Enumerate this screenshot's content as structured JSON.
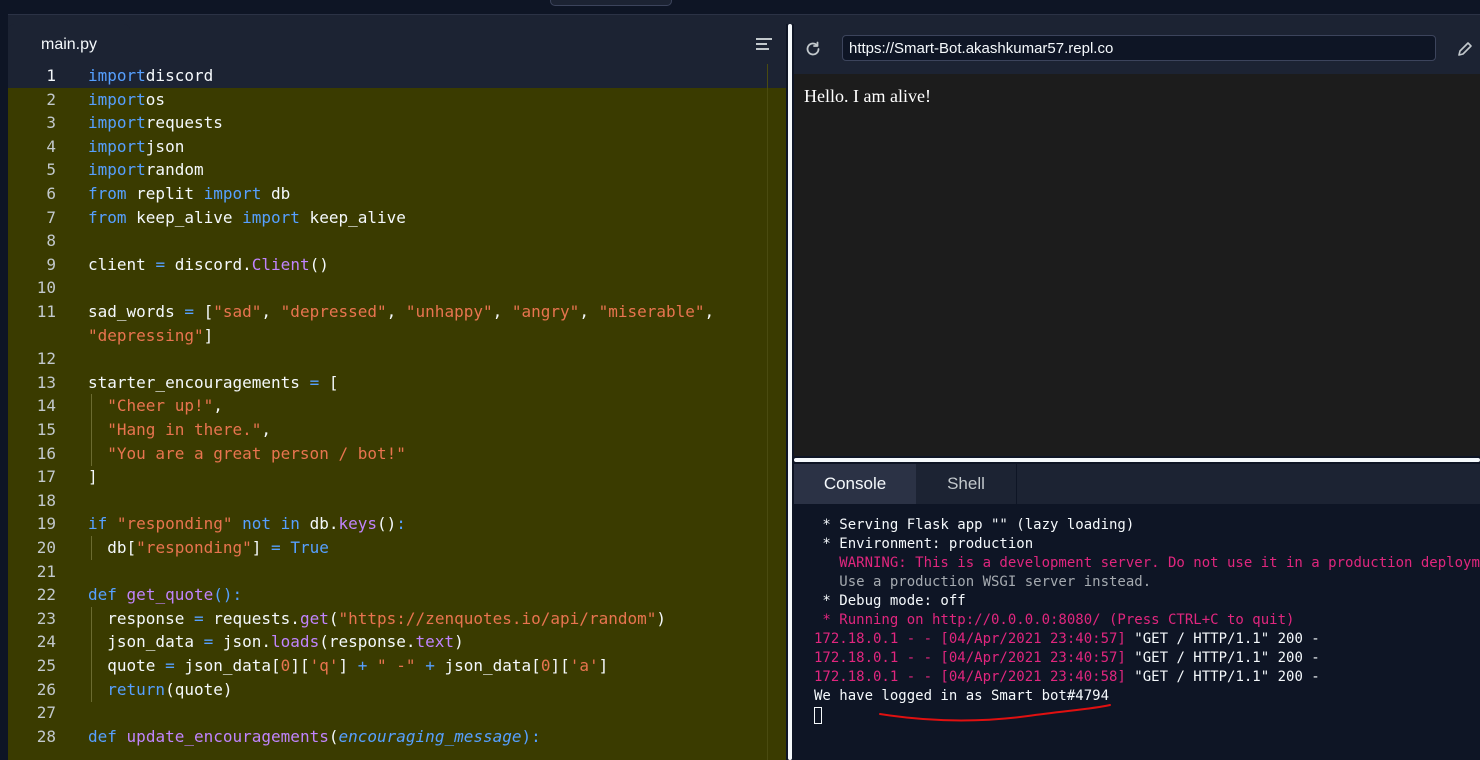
{
  "editor": {
    "file_tab": "main.py",
    "lines": [
      {
        "n": "1",
        "t": [
          [
            "kw",
            "import"
          ],
          [
            "",
            "discord"
          ]
        ]
      },
      {
        "n": "2",
        "t": [
          [
            "kw",
            "import"
          ],
          [
            "",
            "os"
          ]
        ]
      },
      {
        "n": "3",
        "t": [
          [
            "kw",
            "import"
          ],
          [
            "",
            "requests"
          ]
        ]
      },
      {
        "n": "4",
        "t": [
          [
            "kw",
            "import"
          ],
          [
            "",
            "json"
          ]
        ]
      },
      {
        "n": "5",
        "t": [
          [
            "kw",
            "import"
          ],
          [
            "",
            "random"
          ]
        ]
      },
      {
        "n": "6",
        "t": [
          [
            "kw",
            "from"
          ],
          [
            "",
            " replit "
          ],
          [
            "kw",
            "import"
          ],
          [
            "",
            " db"
          ]
        ]
      },
      {
        "n": "7",
        "t": [
          [
            "kw",
            "from"
          ],
          [
            "",
            " keep_alive "
          ],
          [
            "kw",
            "import"
          ],
          [
            "",
            " keep_alive"
          ]
        ]
      },
      {
        "n": "8",
        "t": []
      },
      {
        "n": "9",
        "t": [
          [
            "",
            "client "
          ],
          [
            "kw",
            "="
          ],
          [
            "",
            " discord."
          ],
          [
            "fn",
            "Client"
          ],
          [
            "",
            "()"
          ]
        ]
      },
      {
        "n": "10",
        "t": []
      },
      {
        "n": "11",
        "t": [
          [
            "",
            "sad_words "
          ],
          [
            "kw",
            "="
          ],
          [
            "",
            " ["
          ],
          [
            "str",
            "\"sad\""
          ],
          [
            "",
            ", "
          ],
          [
            "str",
            "\"depressed\""
          ],
          [
            "",
            ", "
          ],
          [
            "str",
            "\"unhappy\""
          ],
          [
            "",
            ", "
          ],
          [
            "str",
            "\"angry\""
          ],
          [
            "",
            ", "
          ],
          [
            "str",
            "\"miserable\""
          ],
          [
            "",
            ","
          ]
        ]
      },
      {
        "n": "",
        "t": [
          [
            "str",
            "\"depressing\""
          ],
          [
            "",
            "]"
          ]
        ]
      },
      {
        "n": "12",
        "t": []
      },
      {
        "n": "13",
        "t": [
          [
            "",
            "starter_encouragements "
          ],
          [
            "kw",
            "="
          ],
          [
            "",
            " ["
          ]
        ]
      },
      {
        "n": "14",
        "i": true,
        "t": [
          [
            "",
            "  "
          ],
          [
            "str",
            "\"Cheer up!\""
          ],
          [
            "",
            ","
          ]
        ]
      },
      {
        "n": "15",
        "i": true,
        "t": [
          [
            "",
            "  "
          ],
          [
            "str",
            "\"Hang in there.\""
          ],
          [
            "",
            ","
          ]
        ]
      },
      {
        "n": "16",
        "i": true,
        "t": [
          [
            "",
            "  "
          ],
          [
            "str",
            "\"You are a great person / bot!\""
          ]
        ]
      },
      {
        "n": "17",
        "t": [
          [
            "",
            "]"
          ]
        ]
      },
      {
        "n": "18",
        "t": []
      },
      {
        "n": "19",
        "t": [
          [
            "kw",
            "if"
          ],
          [
            "",
            " "
          ],
          [
            "str",
            "\"responding\""
          ],
          [
            "",
            " "
          ],
          [
            "kw",
            "not in"
          ],
          [
            "",
            " db."
          ],
          [
            "fn",
            "keys"
          ],
          [
            "",
            "()"
          ],
          [
            "kw",
            ":"
          ]
        ]
      },
      {
        "n": "20",
        "i": true,
        "t": [
          [
            "",
            "  db["
          ],
          [
            "str",
            "\"responding\""
          ],
          [
            "",
            "] "
          ],
          [
            "kw",
            "="
          ],
          [
            "",
            " "
          ],
          [
            "kw",
            "True"
          ]
        ]
      },
      {
        "n": "21",
        "t": []
      },
      {
        "n": "22",
        "t": [
          [
            "kw",
            "def"
          ],
          [
            "",
            " "
          ],
          [
            "fn",
            "get_quote"
          ],
          [
            "kw",
            "():"
          ]
        ]
      },
      {
        "n": "23",
        "i": true,
        "t": [
          [
            "",
            "  response "
          ],
          [
            "kw",
            "="
          ],
          [
            "",
            " requests."
          ],
          [
            "fn",
            "get"
          ],
          [
            "",
            "("
          ],
          [
            "str",
            "\"https://zenquotes.io/api/random\""
          ],
          [
            "",
            ")"
          ]
        ]
      },
      {
        "n": "24",
        "i": true,
        "t": [
          [
            "",
            "  json_data "
          ],
          [
            "kw",
            "="
          ],
          [
            "",
            " json."
          ],
          [
            "fn",
            "loads"
          ],
          [
            "",
            "(response."
          ],
          [
            "fn",
            "text"
          ],
          [
            "",
            ")"
          ]
        ]
      },
      {
        "n": "25",
        "i": true,
        "t": [
          [
            "",
            "  quote "
          ],
          [
            "kw",
            "="
          ],
          [
            "",
            " json_data["
          ],
          [
            "str",
            "0"
          ],
          [
            "",
            "]["
          ],
          [
            "str",
            "'q'"
          ],
          [
            "",
            "] "
          ],
          [
            "kw",
            "+"
          ],
          [
            "",
            " "
          ],
          [
            "str",
            "\" -\""
          ],
          [
            "",
            " "
          ],
          [
            "kw",
            "+"
          ],
          [
            "",
            " json_data["
          ],
          [
            "str",
            "0"
          ],
          [
            "",
            "]["
          ],
          [
            "str",
            "'a'"
          ],
          [
            "",
            "]"
          ]
        ]
      },
      {
        "n": "26",
        "i": true,
        "t": [
          [
            "",
            "  "
          ],
          [
            "kw",
            "return"
          ],
          [
            "",
            "(quote)"
          ]
        ]
      },
      {
        "n": "27",
        "t": []
      },
      {
        "n": "28",
        "t": [
          [
            "kw",
            "def"
          ],
          [
            "",
            " "
          ],
          [
            "fn",
            "update_encouragements"
          ],
          [
            "",
            "("
          ],
          [
            "prm",
            "encouraging_message"
          ],
          [
            "kw",
            "):"
          ]
        ]
      }
    ]
  },
  "webview": {
    "url": "https://Smart-Bot.akashkumar57.repl.co",
    "body_text": "Hello. I am alive!",
    "reload_icon": "reload-icon",
    "edit_icon": "pencil-icon"
  },
  "console": {
    "tabs": [
      "Console",
      "Shell"
    ],
    "lines": [
      {
        "c": "",
        "t": " * Serving Flask app \"\" (lazy loading)"
      },
      {
        "c": "",
        "t": " * Environment: production"
      },
      {
        "c": "warn",
        "t": "   WARNING: This is a development server. Do not use it in a production deployment."
      },
      {
        "c": "dim",
        "t": "   Use a production WSGI server instead."
      },
      {
        "c": "",
        "t": " * Debug mode: off"
      },
      {
        "c": "warn",
        "t": " * Running on http://0.0.0.0:8080/ (Press CTRL+C to quit)"
      },
      {
        "c": "log",
        "ip": "172.18.0.1 - - [04/Apr/2021 23:40:57] ",
        "req": "\"GET / HTTP/1.1\" 200 -"
      },
      {
        "c": "log",
        "ip": "172.18.0.1 - - [04/Apr/2021 23:40:57] ",
        "req": "\"GET / HTTP/1.1\" 200 -"
      },
      {
        "c": "log",
        "ip": "172.18.0.1 - - [04/Apr/2021 23:40:58] ",
        "req": "\"GET / HTTP/1.1\" 200 -"
      },
      {
        "c": "",
        "t": "We have logged in as Smart bot#4794"
      }
    ]
  },
  "colors": {
    "keyword": "#56a0ff",
    "string": "#e8744f",
    "function": "#c084fc",
    "highlight_bg": "#3a3b00",
    "console_warn": "#e0267e",
    "annotation": "#e01010"
  }
}
